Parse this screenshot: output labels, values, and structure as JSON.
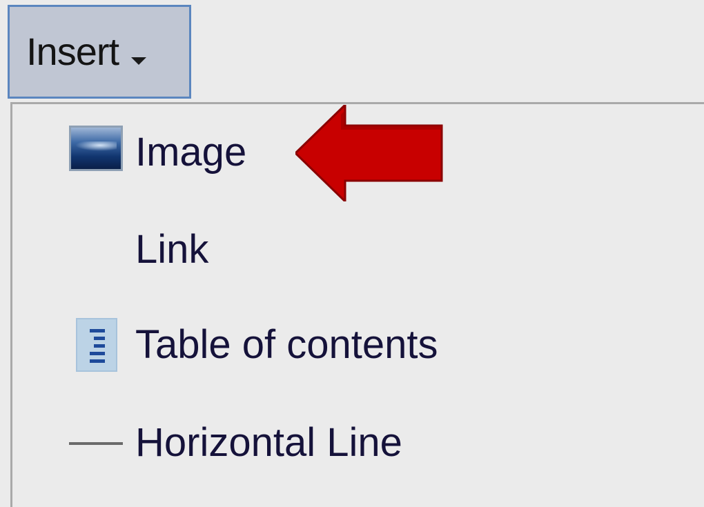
{
  "toolbar": {
    "insert_label": "Insert"
  },
  "menu": {
    "items": [
      {
        "label": "Image",
        "icon": "image-icon"
      },
      {
        "label": "Link",
        "icon": ""
      },
      {
        "label": "Table of contents",
        "icon": "table-of-contents-icon"
      },
      {
        "label": "Horizontal Line",
        "icon": "horizontal-line-icon"
      }
    ]
  },
  "annotation": {
    "arrow_color": "#c80000",
    "target": "Image"
  },
  "colors": {
    "button_bg": "#c0c6d3",
    "button_border": "#5b86bf",
    "menu_bg": "#ebebeb",
    "text": "#15123a"
  }
}
